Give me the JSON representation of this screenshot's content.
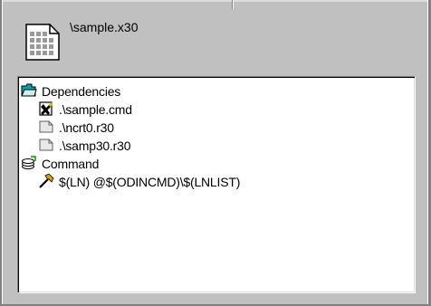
{
  "file": {
    "path": "\\sample.x30",
    "icon": "object-file-icon"
  },
  "tree": {
    "dependencies": {
      "label": "Dependencies",
      "icon": "open-folder-icon",
      "items": [
        {
          "label": ".\\sample.cmd",
          "icon": "command-file-icon"
        },
        {
          "label": ".\\ncrt0.r30",
          "icon": "relocatable-file-icon"
        },
        {
          "label": ".\\samp30.r30",
          "icon": "relocatable-file-icon"
        }
      ]
    },
    "command": {
      "label": "Command",
      "icon": "command-stack-icon",
      "items": [
        {
          "label": "$(LN) @$(ODINCMD)\\$(LNLIST)",
          "icon": "hammer-icon"
        }
      ]
    }
  },
  "colors": {
    "window_bg": "#c0c0c0",
    "tree_bg": "#ffffff",
    "folder": "#00a0a0"
  }
}
